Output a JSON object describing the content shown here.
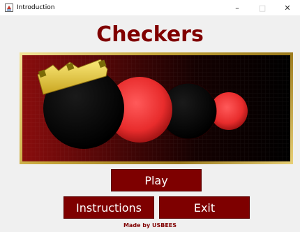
{
  "window": {
    "title": "Introduction",
    "controls": {
      "minimize": "–",
      "maximize": "□",
      "close": "✕"
    }
  },
  "game": {
    "title": "Checkers"
  },
  "banner": {
    "pieces": [
      {
        "name": "black-king-piece",
        "color": "#000000",
        "crowned": true
      },
      {
        "name": "red-piece",
        "color": "#e82c2c"
      },
      {
        "name": "black-piece",
        "color": "#000000"
      },
      {
        "name": "red-piece-small",
        "color": "#e82c2c"
      }
    ],
    "crown_color": "#e8cf3a",
    "frame_color": "#c6a63b",
    "background_left": "#8a0d0d",
    "background_right": "#000000"
  },
  "buttons": {
    "play": "Play",
    "instructions": "Instructions",
    "exit": "Exit",
    "color": "#7e0000"
  },
  "footer": {
    "credit": "Made by USBEES"
  }
}
